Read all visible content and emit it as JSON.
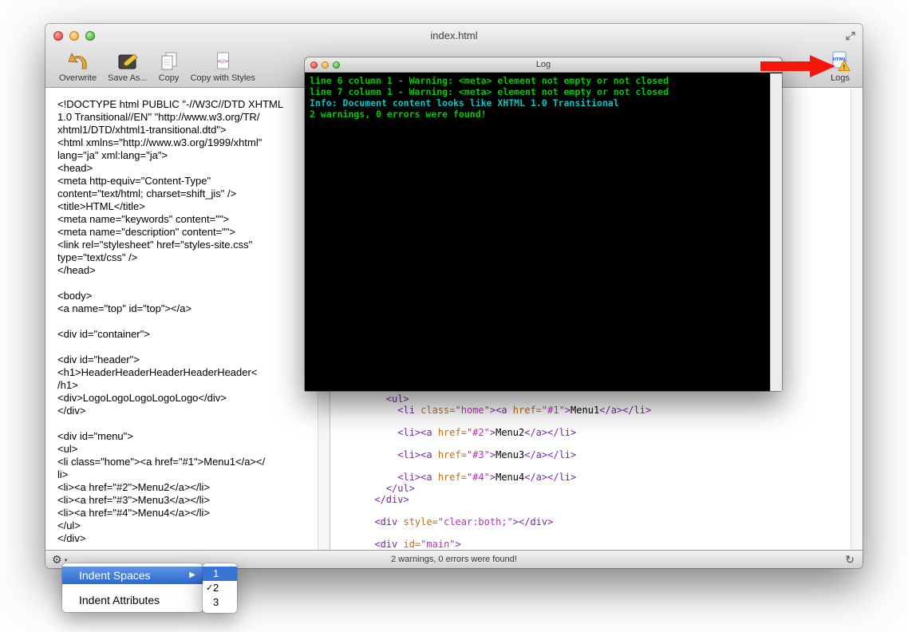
{
  "window": {
    "title": "index.html",
    "toolbar": {
      "buttons": [
        {
          "label": "Overwrite"
        },
        {
          "label": "Save As..."
        },
        {
          "label": "Copy"
        },
        {
          "label": "Copy with Styles"
        },
        {
          "label": "Logs"
        }
      ]
    },
    "status_bar": {
      "status_text": "2 warnings, 0 errors were found!"
    }
  },
  "left_pane": {
    "lines": [
      "<!DOCTYPE html PUBLIC \"-//W3C//DTD XHTML",
      "1.0 Transitional//EN\" \"http://www.w3.org/TR/",
      "xhtml1/DTD/xhtml1-transitional.dtd\">",
      "<html xmlns=\"http://www.w3.org/1999/xhtml\"",
      "lang=\"ja\" xml:lang=\"ja\">",
      "<head>",
      "<meta http-equiv=\"Content-Type\"",
      "content=\"text/html; charset=shift_jis\" />",
      "<title>HTML</title>",
      "<meta name=\"keywords\" content=\"\">",
      "<meta name=\"description\" content=\"\">",
      "<link rel=\"stylesheet\" href=\"styles-site.css\"",
      "type=\"text/css\" />",
      "</head>",
      "",
      "<body>",
      "<a name=\"top\" id=\"top\"></a>",
      "",
      "<div id=\"container\">",
      "",
      "<div id=\"header\">",
      "<h1>HeaderHeaderHeaderHeaderHeader<",
      "/h1>",
      "<div>LogoLogoLogoLogoLogo</div>",
      "</div>",
      "",
      "<div id=\"menu\">",
      "<ul>",
      "<li class=\"home\"><a href=\"#1\">Menu1</a></",
      "li>",
      "<li><a href=\"#2\">Menu2</a></li>",
      "<li><a href=\"#3\">Menu3</a></li>",
      "<li><a href=\"#4\">Menu4</a></li>",
      "</ul>",
      "</div>"
    ]
  },
  "right_pane": {
    "lines": [
      [
        [
          "t",
          "        <ul>"
        ]
      ],
      [
        [
          "t",
          "          <li "
        ],
        [
          "a",
          "class="
        ],
        [
          "s",
          "\"home\""
        ],
        [
          "t",
          "><a "
        ],
        [
          "a",
          "href="
        ],
        [
          "s",
          "\"#1\""
        ],
        [
          "t",
          ">"
        ],
        [
          "x",
          "Menu1"
        ],
        [
          "t",
          "</a></li>"
        ]
      ],
      [],
      [
        [
          "t",
          "          <li><a "
        ],
        [
          "a",
          "href="
        ],
        [
          "s",
          "\"#2\""
        ],
        [
          "t",
          ">"
        ],
        [
          "x",
          "Menu2"
        ],
        [
          "t",
          "</a></li>"
        ]
      ],
      [],
      [
        [
          "t",
          "          <li><a "
        ],
        [
          "a",
          "href="
        ],
        [
          "s",
          "\"#3\""
        ],
        [
          "t",
          ">"
        ],
        [
          "x",
          "Menu3"
        ],
        [
          "t",
          "</a></li>"
        ]
      ],
      [],
      [
        [
          "t",
          "          <li><a "
        ],
        [
          "a",
          "href="
        ],
        [
          "s",
          "\"#4\""
        ],
        [
          "t",
          ">"
        ],
        [
          "x",
          "Menu4"
        ],
        [
          "t",
          "</a></li>"
        ]
      ],
      [
        [
          "t",
          "        </ul>"
        ]
      ],
      [
        [
          "t",
          "      </div>"
        ]
      ],
      [],
      [
        [
          "t",
          "      <div "
        ],
        [
          "a",
          "style="
        ],
        [
          "s",
          "\"clear:both;\""
        ],
        [
          "t",
          "></div>"
        ]
      ],
      [],
      [
        [
          "t",
          "      <div "
        ],
        [
          "a",
          "id="
        ],
        [
          "s",
          "\"main\""
        ],
        [
          "t",
          ">"
        ]
      ]
    ]
  },
  "log_window": {
    "title": "Log",
    "lines": [
      {
        "text": "line 6 column 1 - Warning: <meta> element not empty or not closed",
        "color": "green"
      },
      {
        "text": "line 7 column 1 - Warning: <meta> element not empty or not closed",
        "color": "green"
      },
      {
        "text": "Info: Document content looks like XHTML 1.0 Transitional",
        "color": "cyan"
      },
      {
        "text": "2 warnings, 0 errors were found!",
        "color": "green"
      }
    ]
  },
  "context_menu": {
    "items": [
      {
        "label": "Indent Spaces",
        "highlighted": true,
        "has_submenu": true
      },
      {
        "label": "Indent Attributes",
        "highlighted": false,
        "has_submenu": false
      }
    ],
    "submenu": {
      "items": [
        {
          "label": "1",
          "highlighted": true,
          "checked": false
        },
        {
          "label": "2",
          "highlighted": false,
          "checked": true
        },
        {
          "label": "3",
          "highlighted": false,
          "checked": false
        }
      ]
    }
  },
  "icons": {
    "gear": "⚙",
    "gear_caret": "▼",
    "refresh": "↻",
    "submenu_arrow": "▶",
    "check": "✓",
    "html_label": "HTML",
    "warning_exclaim": "!",
    "code_glyph": "</>"
  },
  "colors": {
    "log_green": "#00cc00",
    "log_cyan": "#00c8c8",
    "menu_highlight": "#3875d7",
    "arrow_red": "#f5150b",
    "syntax_tag": "#7b24a8",
    "syntax_attr": "#c96b12",
    "syntax_string": "#c12bc1"
  }
}
